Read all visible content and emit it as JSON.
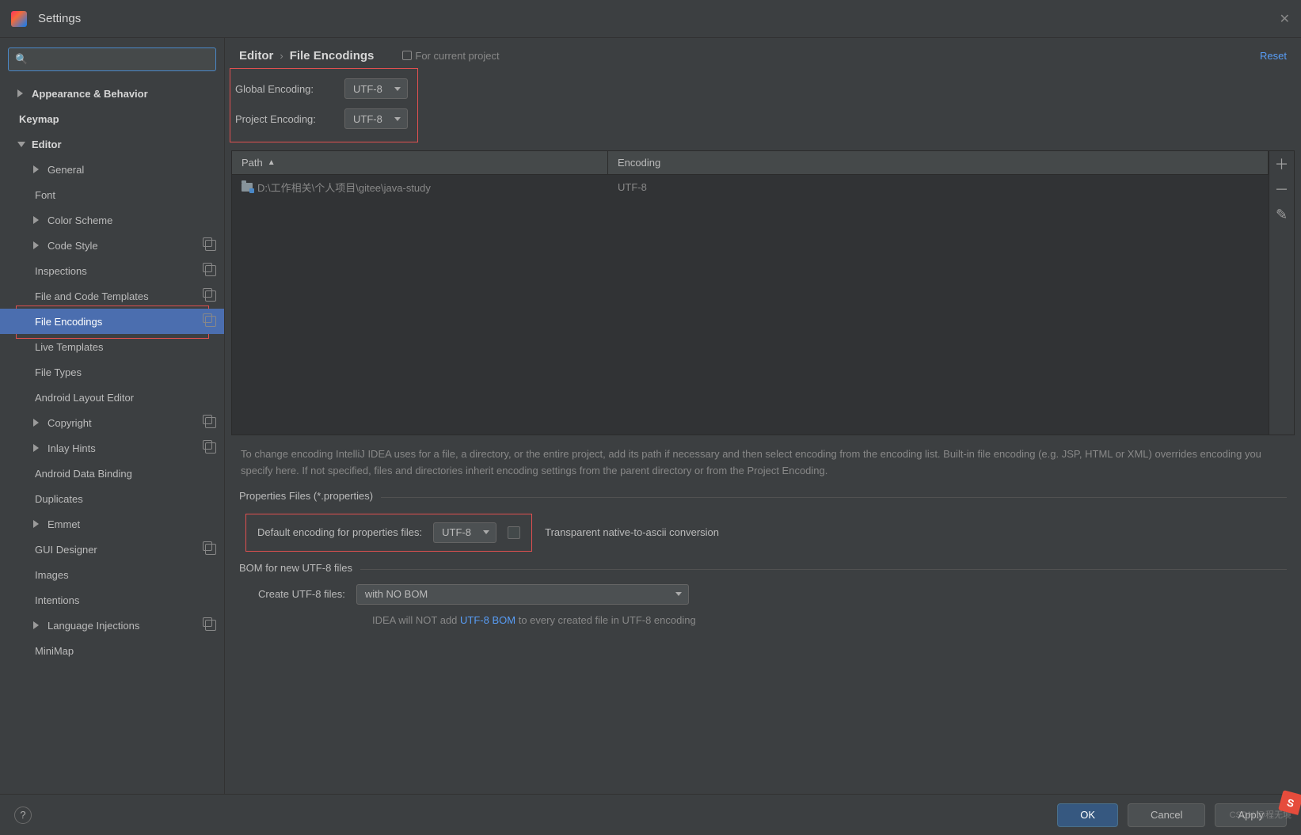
{
  "titlebar": {
    "title": "Settings"
  },
  "search": {
    "placeholder": ""
  },
  "sidebar": {
    "items": [
      {
        "label": "Appearance & Behavior",
        "bold": true,
        "chev": "right"
      },
      {
        "label": "Keymap",
        "bold": true
      },
      {
        "label": "Editor",
        "bold": true,
        "chev": "down"
      },
      {
        "label": "General",
        "lvl": 1,
        "chev": "right"
      },
      {
        "label": "Font",
        "lvl": 1
      },
      {
        "label": "Color Scheme",
        "lvl": 1,
        "chev": "right"
      },
      {
        "label": "Code Style",
        "lvl": 1,
        "chev": "right",
        "proj": true
      },
      {
        "label": "Inspections",
        "lvl": 1,
        "proj": true
      },
      {
        "label": "File and Code Templates",
        "lvl": 1,
        "proj": true
      },
      {
        "label": "File Encodings",
        "lvl": 1,
        "proj": true,
        "selected": true
      },
      {
        "label": "Live Templates",
        "lvl": 1
      },
      {
        "label": "File Types",
        "lvl": 1
      },
      {
        "label": "Android Layout Editor",
        "lvl": 1
      },
      {
        "label": "Copyright",
        "lvl": 1,
        "chev": "right",
        "proj": true
      },
      {
        "label": "Inlay Hints",
        "lvl": 1,
        "chev": "right",
        "proj": true
      },
      {
        "label": "Android Data Binding",
        "lvl": 1
      },
      {
        "label": "Duplicates",
        "lvl": 1
      },
      {
        "label": "Emmet",
        "lvl": 1,
        "chev": "right"
      },
      {
        "label": "GUI Designer",
        "lvl": 1,
        "proj": true
      },
      {
        "label": "Images",
        "lvl": 1
      },
      {
        "label": "Intentions",
        "lvl": 1
      },
      {
        "label": "Language Injections",
        "lvl": 1,
        "chev": "right",
        "proj": true
      },
      {
        "label": "MiniMap",
        "lvl": 1
      }
    ]
  },
  "breadcrumb": {
    "a": "Editor",
    "b": "File Encodings",
    "badge": "For current project",
    "reset": "Reset"
  },
  "encodings": {
    "global_label": "Global Encoding:",
    "global_value": "UTF-8",
    "project_label": "Project Encoding:",
    "project_value": "UTF-8"
  },
  "table": {
    "col_path": "Path",
    "col_enc": "Encoding",
    "rows": [
      {
        "path": "D:\\工作相关\\个人项目\\gitee\\java-study",
        "enc": "UTF-8"
      }
    ]
  },
  "help_text": "To change encoding IntelliJ IDEA uses for a file, a directory, or the entire project, add its path if necessary and then select encoding from the encoding list. Built-in file encoding (e.g. JSP, HTML or XML) overrides encoding you specify here. If not specified, files and directories inherit encoding settings from the parent directory or from the Project Encoding.",
  "properties": {
    "legend": "Properties Files (*.properties)",
    "default_label": "Default encoding for properties files:",
    "default_value": "UTF-8",
    "transparent_label": "Transparent native-to-ascii conversion"
  },
  "bom": {
    "legend": "BOM for new UTF-8 files",
    "create_label": "Create UTF-8 files:",
    "create_value": "with NO BOM",
    "note_pre": "IDEA will NOT add ",
    "note_link": "UTF-8 BOM",
    "note_post": " to every created file in UTF-8 encoding"
  },
  "footer": {
    "ok": "OK",
    "cancel": "Cancel",
    "apply": "Apply"
  },
  "watermark": "CSDN @程无境",
  "ime": "S"
}
